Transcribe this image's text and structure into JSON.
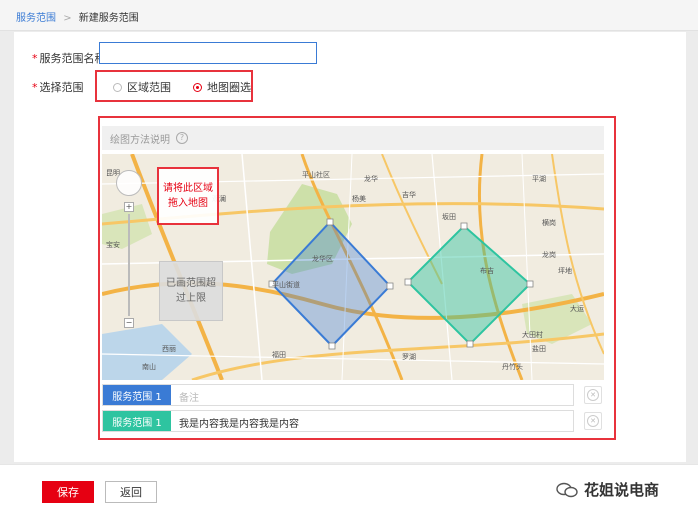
{
  "breadcrumb": {
    "parent": "服务范围",
    "separator": ">",
    "current": "新建服务范围"
  },
  "form": {
    "name_required_mark": "*",
    "name_label": "服务范围名称",
    "name_value": "",
    "range_required_mark": "*",
    "range_label": "选择范围",
    "options": [
      {
        "label": "区域范围",
        "checked": false
      },
      {
        "label": "地图圈选",
        "checked": true
      }
    ]
  },
  "map_section": {
    "method_label": "绘图方法说明",
    "help_icon": "?",
    "callout_drag": "请将此区域拖入地图",
    "callout_exceed": "已画范围超过上限",
    "place_labels": [
      "昆明",
      "平山社区",
      "平山街道",
      "龙华",
      "龙华区",
      "坂田",
      "布吉",
      "平湖",
      "观澜",
      "横岗",
      "龙岗",
      "大运",
      "西丽",
      "南山",
      "宝安",
      "福田",
      "罗湖",
      "盐田",
      "坪地",
      "杨美",
      "吉华",
      "大田村",
      "丹竹头"
    ],
    "shapes": [
      {
        "name": "服务范围 1",
        "color": "#3a7bd5"
      },
      {
        "name": "服务范围 1",
        "color": "#2ec4a0"
      }
    ]
  },
  "service_rows": [
    {
      "tag": "服务范围 1",
      "tag_color": "#3a7bd5",
      "text": "备注",
      "is_placeholder": true
    },
    {
      "tag": "服务范围 1",
      "tag_color": "#2ec4a0",
      "text": "我是内容我是内容我是内容",
      "is_placeholder": false
    }
  ],
  "footer": {
    "save_label": "保存",
    "back_label": "返回",
    "watermark": "花姐说电商"
  },
  "colors": {
    "primary_red": "#e60012",
    "link_blue": "#3a7bd5",
    "teal": "#2ec4a0"
  }
}
